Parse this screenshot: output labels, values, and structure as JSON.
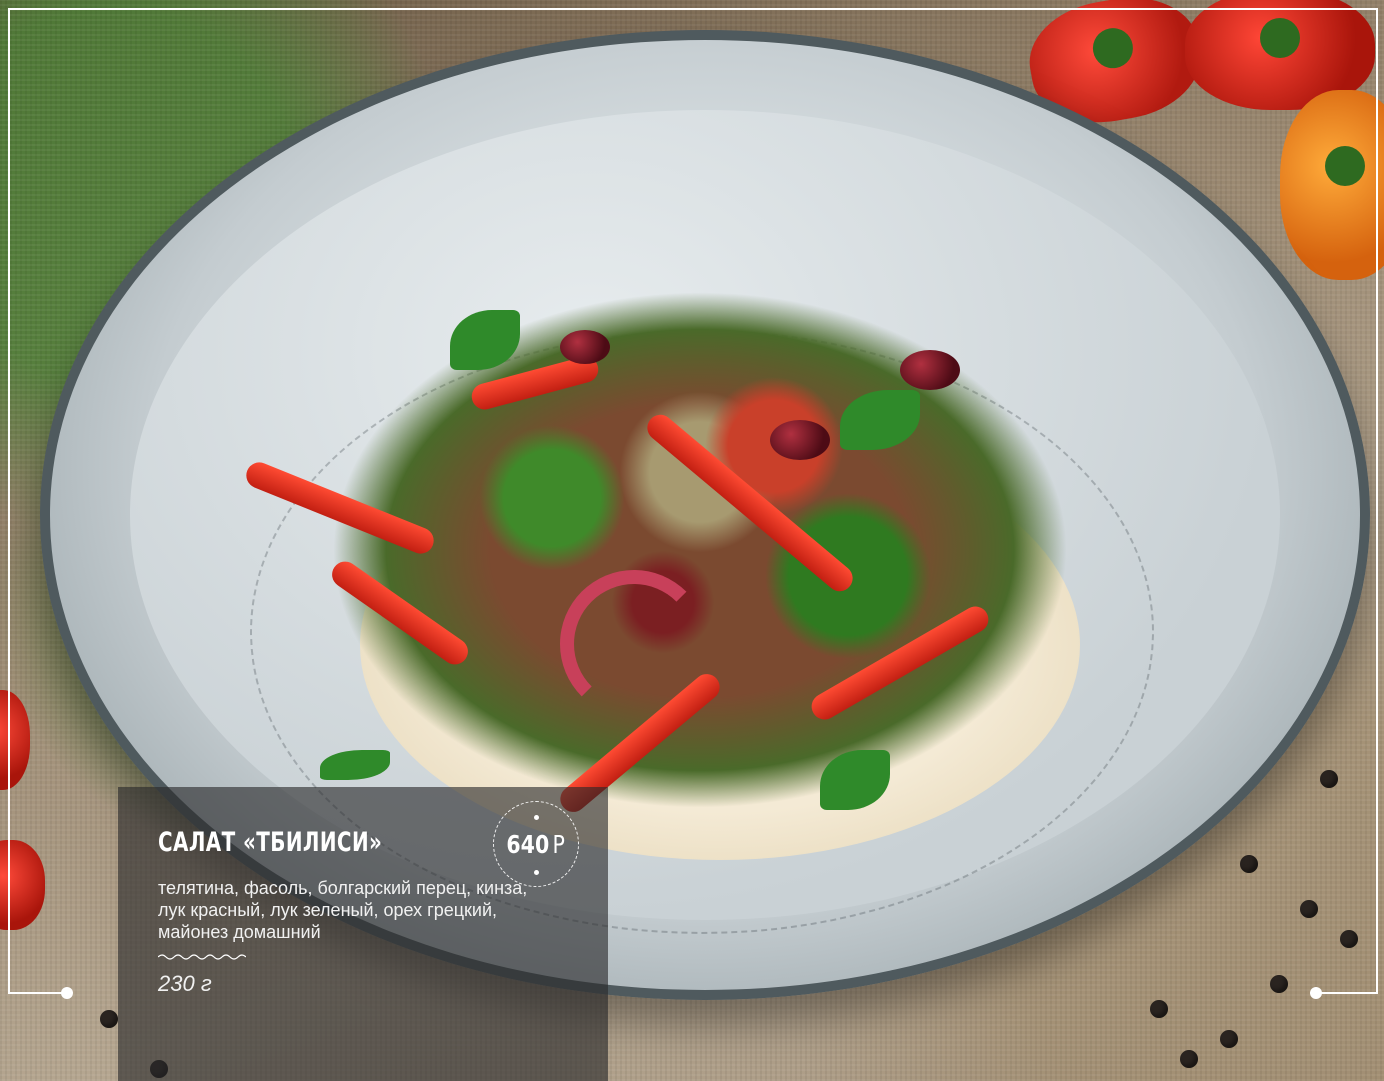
{
  "dish": {
    "title": "САЛАТ «ТБИЛИСИ»",
    "price_value": "640",
    "price_currency": "Р",
    "description": "телятина, фасоль, болгарский перец, кинза, лук красный, лук зеленый, орех грецкий, майонез домашний",
    "weight": "230 г"
  },
  "colors": {
    "card_bg": "#28282a",
    "frame": "#ffffff",
    "text": "#ffffff"
  }
}
